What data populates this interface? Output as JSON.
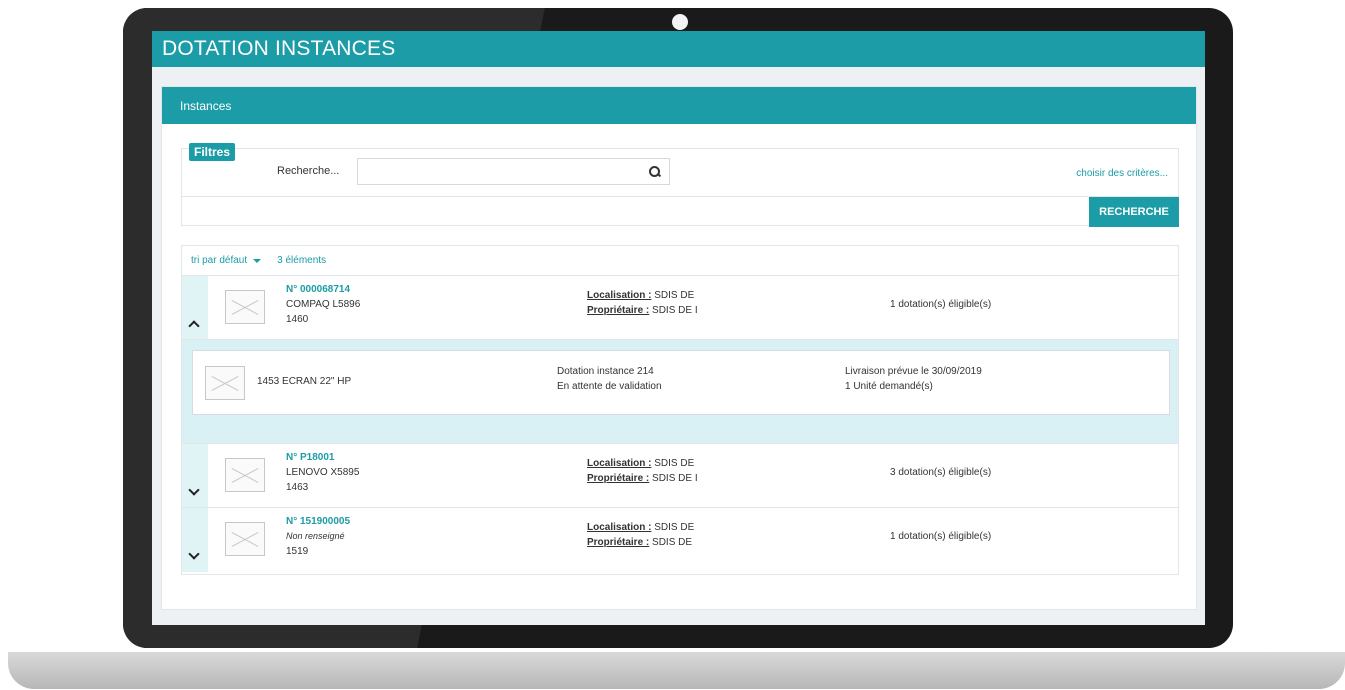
{
  "app": {
    "title": "DOTATION INSTANCES"
  },
  "panel": {
    "title": "Instances"
  },
  "filters": {
    "legend": "Filtres",
    "search_label": "Recherche...",
    "search_value": "",
    "criteria_link": "choisir des critères...",
    "search_button": "RECHERCHE",
    "search_icon": "search-icon"
  },
  "list": {
    "sort_label": "tri par défaut",
    "count_label": "3 éléments",
    "rows": [
      {
        "number": "N° 000068714",
        "model": "COMPAQ L5896",
        "code": "1460",
        "location_key": "Localisation :",
        "location_value": "SDIS DE",
        "owner_key": "Propriétaire :",
        "owner_value": "SDIS DE I",
        "eligible": "1 dotation(s) éligible(s)",
        "expanded": true
      },
      {
        "number": "N° P18001",
        "model": "LENOVO X5895",
        "code": "1463",
        "location_key": "Localisation :",
        "location_value": "SDIS DE",
        "owner_key": "Propriétaire :",
        "owner_value": "SDIS DE I",
        "eligible": "3 dotation(s) éligible(s)",
        "expanded": false
      },
      {
        "number": "N° 151900005",
        "model": "Non renseigné",
        "code": "1519",
        "location_key": "Localisation :",
        "location_value": "SDIS DE",
        "owner_key": "Propriétaire :",
        "owner_value": "SDIS DE",
        "eligible": "1 dotation(s) éligible(s)",
        "expanded": false
      }
    ],
    "detail": {
      "item": "1453 ECRAN 22\" HP",
      "instance": "Dotation instance 214",
      "status": "En attente de validation",
      "delivery": "Livraison prévue le 30/09/2019",
      "quantity": "1 Unité demandé(s)"
    }
  },
  "colors": {
    "accent": "#1b9ca6",
    "expanded_bg": "#d9f1f4"
  }
}
